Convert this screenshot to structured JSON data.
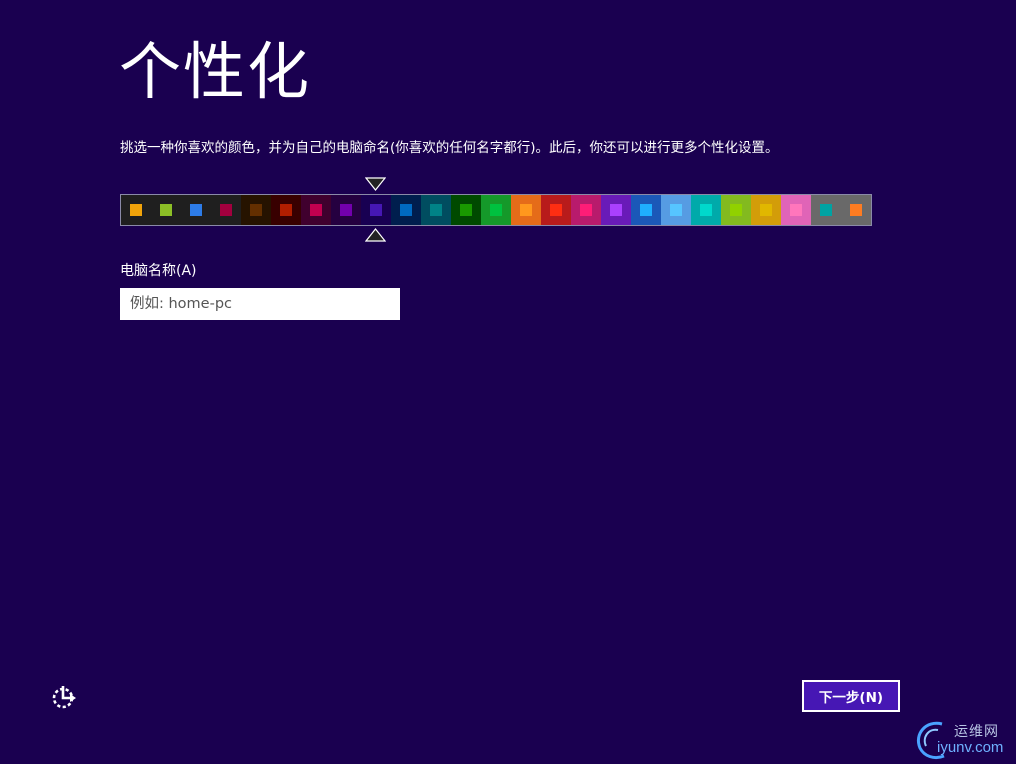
{
  "header": {
    "title": "个性化"
  },
  "instructions": "挑选一种你喜欢的颜色，并为自己的电脑命名(你喜欢的任何名字都行)。此后，你还可以进行更多个性化设置。",
  "palette": {
    "selected_index": 8,
    "swatches": [
      {
        "bg": "#1f1f1f",
        "dot": "#f0a30a"
      },
      {
        "bg": "#1f1f1f",
        "dot": "#8cbf26"
      },
      {
        "bg": "#1f1f1f",
        "dot": "#2d7ce8"
      },
      {
        "bg": "#1f1f1f",
        "dot": "#a2003e"
      },
      {
        "bg": "#261300",
        "dot": "#632f00"
      },
      {
        "bg": "#380000",
        "dot": "#b01e00"
      },
      {
        "bg": "#40002e",
        "dot": "#c1004f"
      },
      {
        "bg": "#250040",
        "dot": "#7200ac"
      },
      {
        "bg": "#180052",
        "dot": "#4617b4"
      },
      {
        "bg": "#001e4e",
        "dot": "#006ac1"
      },
      {
        "bg": "#004d60",
        "dot": "#008287"
      },
      {
        "bg": "#004a00",
        "dot": "#199900"
      },
      {
        "bg": "#15992a",
        "dot": "#00c13f"
      },
      {
        "bg": "#e56c19",
        "dot": "#ff981d"
      },
      {
        "bg": "#b81b1b",
        "dot": "#ff2e12"
      },
      {
        "bg": "#b81b6c",
        "dot": "#ff1d77"
      },
      {
        "bg": "#691bb8",
        "dot": "#aa40ff"
      },
      {
        "bg": "#1b58b8",
        "dot": "#1faeff"
      },
      {
        "bg": "#569ce3",
        "dot": "#56c5ff"
      },
      {
        "bg": "#00aaaa",
        "dot": "#00d8cc"
      },
      {
        "bg": "#83ba1f",
        "dot": "#91d100"
      },
      {
        "bg": "#d39d09",
        "dot": "#e1b700"
      },
      {
        "bg": "#e064b7",
        "dot": "#ff76bc"
      },
      {
        "bg": "#696969",
        "dot": "#00a3a3"
      },
      {
        "bg": "#696969",
        "dot": "#fe7c22"
      }
    ]
  },
  "computer_name": {
    "label": "电脑名称(A)",
    "placeholder": "例如: home-pc",
    "value": ""
  },
  "footer": {
    "ease_icon": "ease-of-access-icon",
    "next_label": "下一步(N)"
  },
  "watermark": {
    "cn": "运维网",
    "en": "iyunv.com"
  },
  "colors": {
    "background": "#1a0050",
    "accent": "#4617b4"
  }
}
